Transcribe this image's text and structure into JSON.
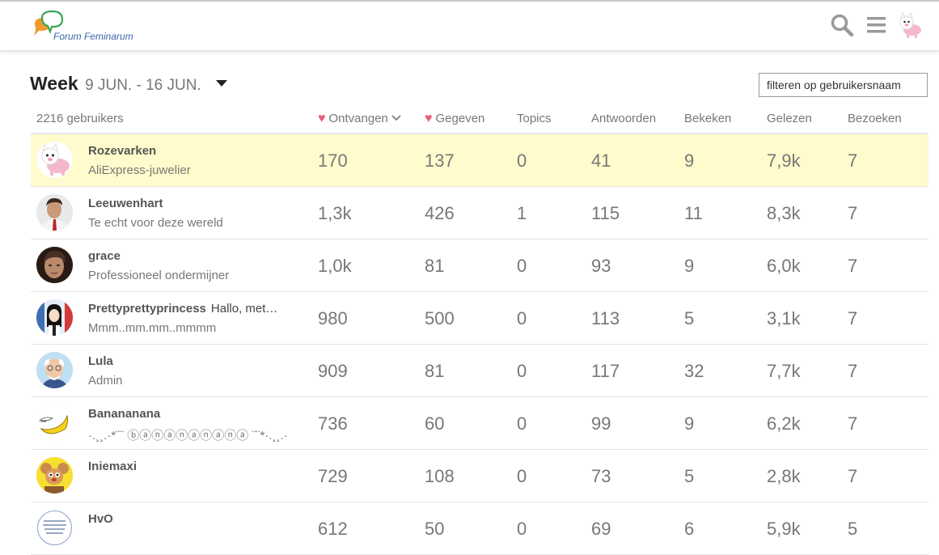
{
  "header": {
    "logo_text": "Forum Feminarum",
    "icons": [
      "search-icon",
      "hamburger-menu-icon",
      "user-avatar-icon"
    ]
  },
  "period": {
    "label": "Week",
    "range": "9 JUN. - 16 JUN."
  },
  "filter": {
    "placeholder": "filteren op gebruikersnaam",
    "value": ""
  },
  "table": {
    "user_count": "2216 gebruikers",
    "columns": {
      "received": "Ontvangen",
      "given": "Gegeven",
      "topics": "Topics",
      "replies": "Antwoorden",
      "viewed": "Bekeken",
      "read": "Gelezen",
      "visits": "Bezoeken"
    },
    "rows": [
      {
        "name": "Rozevarken",
        "extra": "",
        "title": "AliExpress-juwelier",
        "received": "170",
        "given": "137",
        "topics": "0",
        "replies": "41",
        "viewed": "9",
        "read": "7,9k",
        "visits": "7",
        "avatar": "pink-cat"
      },
      {
        "name": "Leeuwenhart",
        "extra": "",
        "title": "Te echt voor deze wereld",
        "received": "1,3k",
        "given": "426",
        "topics": "1",
        "replies": "115",
        "viewed": "11",
        "read": "8,3k",
        "visits": "7",
        "avatar": "man-photo"
      },
      {
        "name": "grace",
        "extra": "",
        "title": "Professioneel ondermijner",
        "received": "1,0k",
        "given": "81",
        "topics": "0",
        "replies": "93",
        "viewed": "9",
        "read": "6,0k",
        "visits": "7",
        "avatar": "face-photo"
      },
      {
        "name": "Prettyprettyprincess",
        "extra": "Hallo, met…",
        "title": "Mmm..mm.mm..mmmm",
        "received": "980",
        "given": "500",
        "topics": "0",
        "replies": "113",
        "viewed": "5",
        "read": "3,1k",
        "visits": "7",
        "avatar": "girl-drawing"
      },
      {
        "name": "Lula",
        "extra": "",
        "title": "Admin",
        "received": "909",
        "given": "81",
        "topics": "0",
        "replies": "117",
        "viewed": "32",
        "read": "7,7k",
        "visits": "7",
        "avatar": "old-man"
      },
      {
        "name": "Banananana",
        "extra": "",
        "title": "·.¸¸.·*¨¨ ⓑⓐⓝⓐⓝⓐⓝⓐⓝⓐ ¨¨*·.¸¸.·",
        "received": "736",
        "given": "60",
        "topics": "0",
        "replies": "99",
        "viewed": "9",
        "read": "6,2k",
        "visits": "7",
        "avatar": "banana"
      },
      {
        "name": "Iniemaxi",
        "extra": "",
        "title": "",
        "received": "729",
        "given": "108",
        "topics": "0",
        "replies": "73",
        "viewed": "5",
        "read": "2,8k",
        "visits": "7",
        "avatar": "cartoon-mouse"
      },
      {
        "name": "HvO",
        "extra": "",
        "title": "",
        "received": "612",
        "given": "50",
        "topics": "0",
        "replies": "69",
        "viewed": "6",
        "read": "5,9k",
        "visits": "5",
        "avatar": "text-stamp"
      }
    ]
  }
}
